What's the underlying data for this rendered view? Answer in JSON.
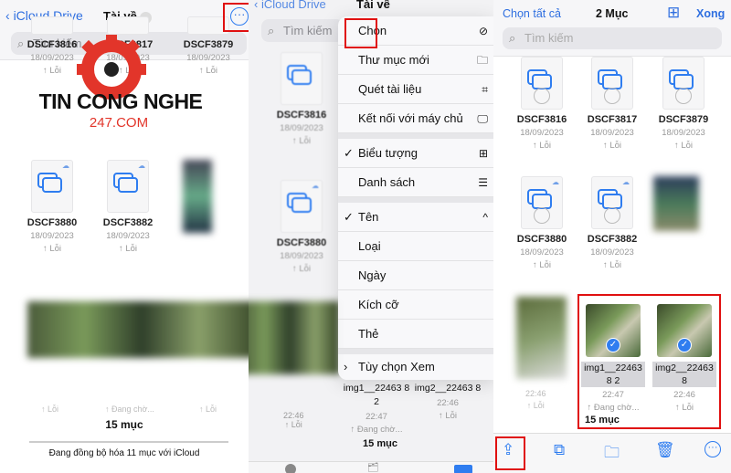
{
  "panel1": {
    "back_label": "iCloud Drive",
    "title": "Tài về",
    "search_placeholder": "Tìm kiếm",
    "items": [
      {
        "name": "DSCF3816",
        "date": "18/09/2023",
        "status": "↑ Lỗi"
      },
      {
        "name": "DSCF3817",
        "date": "18/09/2023",
        "status": "↑ Lỗi"
      },
      {
        "name": "DSCF3879",
        "date": "18/09/2023",
        "status": "↑ Lỗi"
      },
      {
        "name": "DSCF3880",
        "date": "18/09/2023",
        "status": "↑ Lỗi"
      },
      {
        "name": "DSCF3882",
        "date": "18/09/2023",
        "status": "↑ Lỗi"
      }
    ],
    "row3_status": [
      "↑ Lỗi",
      "↑ Đang chờ...",
      "↑ Lỗi"
    ],
    "count": "15 mục",
    "sync_status": "Đang đồng bộ hóa 11 mục với iCloud"
  },
  "watermark": {
    "line1": "TIN CONG NGHE",
    "line2": "247.COM"
  },
  "panel2": {
    "back_label": "iCloud Drive",
    "title": "Tài về",
    "search_placeholder": "Tìm kiếm",
    "bg_item": {
      "name": "DSCF3816",
      "date": "18/09/2023",
      "status": "↑ Lỗi"
    },
    "bg_item2": {
      "name": "DSCF3880",
      "date": "18/09/2023",
      "status": "↑ Lỗi"
    },
    "menu": {
      "group1": [
        {
          "label": "Chọn",
          "icon": "checkmark-circle-icon",
          "glyph": "⊘"
        },
        {
          "label": "Thư mục mới",
          "icon": "folder-plus-icon",
          "glyph": "🗀"
        },
        {
          "label": "Quét tài liệu",
          "icon": "scan-document-icon",
          "glyph": "⌗"
        },
        {
          "label": "Kết nối với máy chủ",
          "icon": "server-icon",
          "glyph": "🖵"
        }
      ],
      "group2": [
        {
          "label": "Biểu tượng",
          "checked": true,
          "icon": "grid-icon",
          "glyph": "⊞"
        },
        {
          "label": "Danh sách",
          "checked": false,
          "icon": "list-icon",
          "glyph": "☰"
        }
      ],
      "group3": [
        {
          "label": "Tên",
          "checked": true,
          "icon": "chevron-up-icon",
          "glyph": "^"
        },
        {
          "label": "Loại"
        },
        {
          "label": "Ngày"
        },
        {
          "label": "Kích cỡ"
        },
        {
          "label": "Thẻ"
        }
      ],
      "view_options": "Tùy chọn Xem"
    },
    "bottom_items": [
      {
        "name": "img1__22463 8 2",
        "time": "22:47",
        "status": "↑ Đang chờ..."
      },
      {
        "name": "img2__22463 8",
        "time": "22:46",
        "status": "↑ Lỗi"
      }
    ],
    "bg_time": "22:46",
    "bg_status": "↑ Lỗi",
    "count": "15 mục"
  },
  "panel3": {
    "select_all": "Chọn tất cả",
    "title": "2 Mục",
    "done": "Xong",
    "search_placeholder": "Tìm kiếm",
    "items": [
      {
        "name": "DSCF3816",
        "date": "18/09/2023",
        "status": "↑ Lỗi"
      },
      {
        "name": "DSCF3817",
        "date": "18/09/2023",
        "status": "↑ Lỗi"
      },
      {
        "name": "DSCF3879",
        "date": "18/09/2023",
        "status": "↑ Lỗi"
      },
      {
        "name": "DSCF3880",
        "date": "18/09/2023",
        "status": "↑ Lỗi"
      },
      {
        "name": "DSCF3882",
        "date": "18/09/2023",
        "status": "↑ Lỗi"
      }
    ],
    "selected": [
      {
        "name": "img1__22463 8 2",
        "time": "22:47",
        "status": "↑ Đang chờ...",
        "selected": true
      },
      {
        "name": "img2__22463 8",
        "time": "22:46",
        "status": "↑ Lỗi",
        "selected": true
      }
    ],
    "blur_time": "22:46",
    "blur_status": "↑ Lỗi",
    "count": "15 mục",
    "toolbar": [
      "share-icon",
      "duplicate-icon",
      "move-folder-icon",
      "trash-icon",
      "more-icon"
    ]
  },
  "colors": {
    "accent": "#2f7df0",
    "highlight": "#e01010"
  }
}
